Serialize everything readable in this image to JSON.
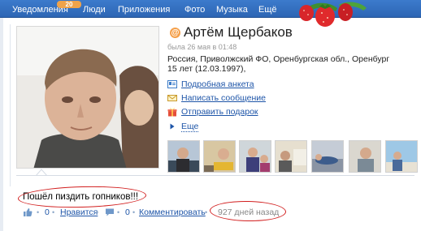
{
  "nav": {
    "items": [
      {
        "label": "Уведомления",
        "icon": "bell-icon"
      },
      {
        "label": "Люди",
        "icon": "people-icon"
      },
      {
        "label": "Приложения",
        "icon": "apps-icon"
      },
      {
        "label": "Фото",
        "icon": "photo-icon"
      },
      {
        "label": "Музыка",
        "icon": "music-icon"
      },
      {
        "label": "Ещё",
        "icon": "more-icon"
      }
    ],
    "badge": "20",
    "bar_color": "#3c7bcc"
  },
  "profile": {
    "name": "Артём Щербаков",
    "online_icon": "@",
    "last_seen": "была 26  мая  в 01:48",
    "location": "Россия, Приволжский ФО, Оренбургская обл., Оренбург",
    "age": "15 лет (12.03.1997),"
  },
  "actions": [
    {
      "label": "Подробная анкета",
      "icon": "profile-card-icon"
    },
    {
      "label": "Написать сообщение",
      "icon": "message-icon"
    },
    {
      "label": "Отправить подарок",
      "icon": "gift-icon"
    },
    {
      "label": "Еще",
      "icon": "triangle-right-icon"
    }
  ],
  "status": {
    "text": "Пошёл пиздить гопников!!!"
  },
  "stats": {
    "like_count": "0",
    "like_label": "Нравится",
    "comment_count": "0",
    "comment_label": "Комментировать",
    "time_ago": "927 дней назад"
  },
  "colors": {
    "link": "#1e55a8",
    "highlight": "#d21f1f",
    "accent": "#f5a04a"
  }
}
